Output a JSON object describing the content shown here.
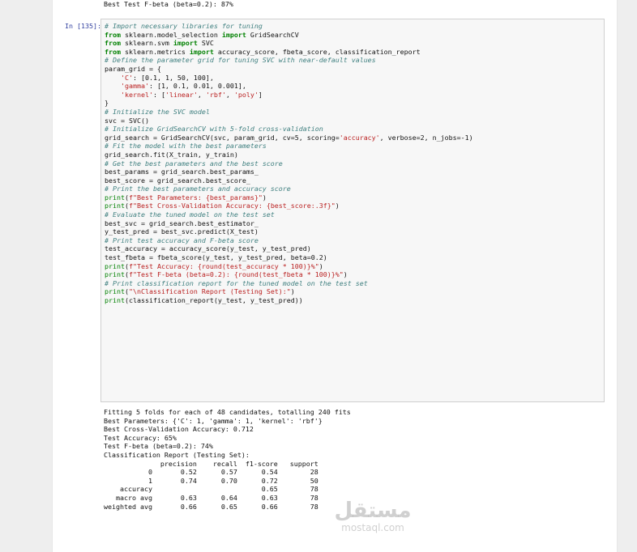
{
  "top_output": "Best Test F-beta (beta=0.2): 87%",
  "cell": {
    "prompt": "In [135]:",
    "code_lines": [
      "# Import necessary libraries for tuning",
      "from sklearn.model_selection import GridSearchCV",
      "from sklearn.svm import SVC",
      "from sklearn.metrics import accuracy_score, fbeta_score, classification_report",
      "",
      "# Define the parameter grid for tuning SVC with near-default values",
      "param_grid = {",
      "    'C': [0.1, 1, 50, 100],",
      "    'gamma': [1, 0.1, 0.01, 0.001],",
      "    'kernel': ['linear', 'rbf', 'poly']",
      "}",
      "",
      "",
      "# Initialize the SVC model",
      "svc = SVC()",
      "",
      "# Initialize GridSearchCV with 5-fold cross-validation",
      "grid_search = GridSearchCV(svc, param_grid, cv=5, scoring='accuracy', verbose=2, n_jobs=-1)",
      "",
      "# Fit the model with the best parameters",
      "grid_search.fit(X_train, y_train)",
      "",
      "# Get the best parameters and the best score",
      "best_params = grid_search.best_params_",
      "best_score = grid_search.best_score_",
      "",
      "# Print the best parameters and accuracy score",
      "print(f\"Best Parameters: {best_params}\")",
      "print(f\"Best Cross-Validation Accuracy: {best_score:.3f}\")",
      "",
      "# Evaluate the tuned model on the test set",
      "best_svc = grid_search.best_estimator_",
      "y_test_pred = best_svc.predict(X_test)",
      "",
      "# Print test accuracy and F-beta score",
      "test_accuracy = accuracy_score(y_test, y_test_pred)",
      "test_fbeta = fbeta_score(y_test, y_test_pred, beta=0.2)",
      "",
      "print(f\"Test Accuracy: {round(test_accuracy * 100)}%\")",
      "print(f\"Test F-beta (beta=0.2): {round(test_fbeta * 100)}%\")",
      "",
      "# Print classification report for the tuned model on the test set",
      "print(\"\\nClassification Report (Testing Set):\")",
      "print(classification_report(y_test, y_test_pred))"
    ]
  },
  "output_lines": [
    "Fitting 5 folds for each of 48 candidates, totalling 240 fits",
    "Best Parameters: {'C': 1, 'gamma': 1, 'kernel': 'rbf'}",
    "Best Cross-Validation Accuracy: 0.712",
    "Test Accuracy: 65%",
    "Test F-beta (beta=0.2): 74%",
    "",
    "Classification Report (Testing Set):",
    "              precision    recall  f1-score   support",
    "",
    "           0       0.52      0.57      0.54        28",
    "           1       0.74      0.70      0.72        50",
    "",
    "    accuracy                           0.65        78",
    "   macro avg       0.63      0.64      0.63        78",
    "weighted avg       0.66      0.65      0.66        78"
  ],
  "watermark": {
    "arabic": "مستقل",
    "latin": "mostaql.com"
  }
}
